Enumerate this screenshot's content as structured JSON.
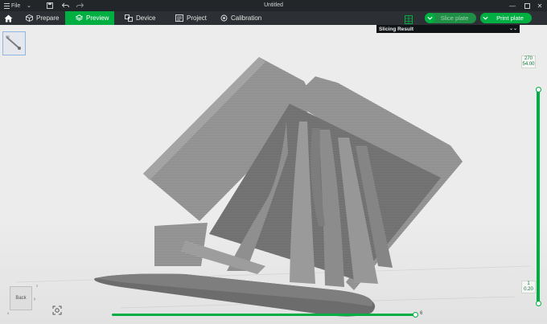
{
  "titlebar": {
    "file_label": "File",
    "window_title": "Untitled"
  },
  "toolbar": {
    "tabs": [
      {
        "label": "Prepare",
        "icon": "cube-icon",
        "active": false
      },
      {
        "label": "Preview",
        "icon": "layers-icon",
        "active": true
      },
      {
        "label": "Device",
        "icon": "device-icon",
        "active": false
      },
      {
        "label": "Project",
        "icon": "project-icon",
        "active": false
      },
      {
        "label": "Calibration",
        "icon": "calibration-icon",
        "active": false
      }
    ],
    "slice_label": "Slice plate",
    "print_label": "Print plate"
  },
  "slicing_result": {
    "label": "Slicing Result"
  },
  "layer_slider": {
    "top_layer": "270",
    "top_height": "54.00",
    "bottom_layer": "1",
    "bottom_height": "0.20"
  },
  "move_slider": {
    "value": "6"
  },
  "nav_cube": {
    "face_label": "Back"
  },
  "colors": {
    "accent": "#00ae42",
    "titlebar": "#232629",
    "toolbar": "#2c2f33",
    "viewport": "#ececec"
  }
}
